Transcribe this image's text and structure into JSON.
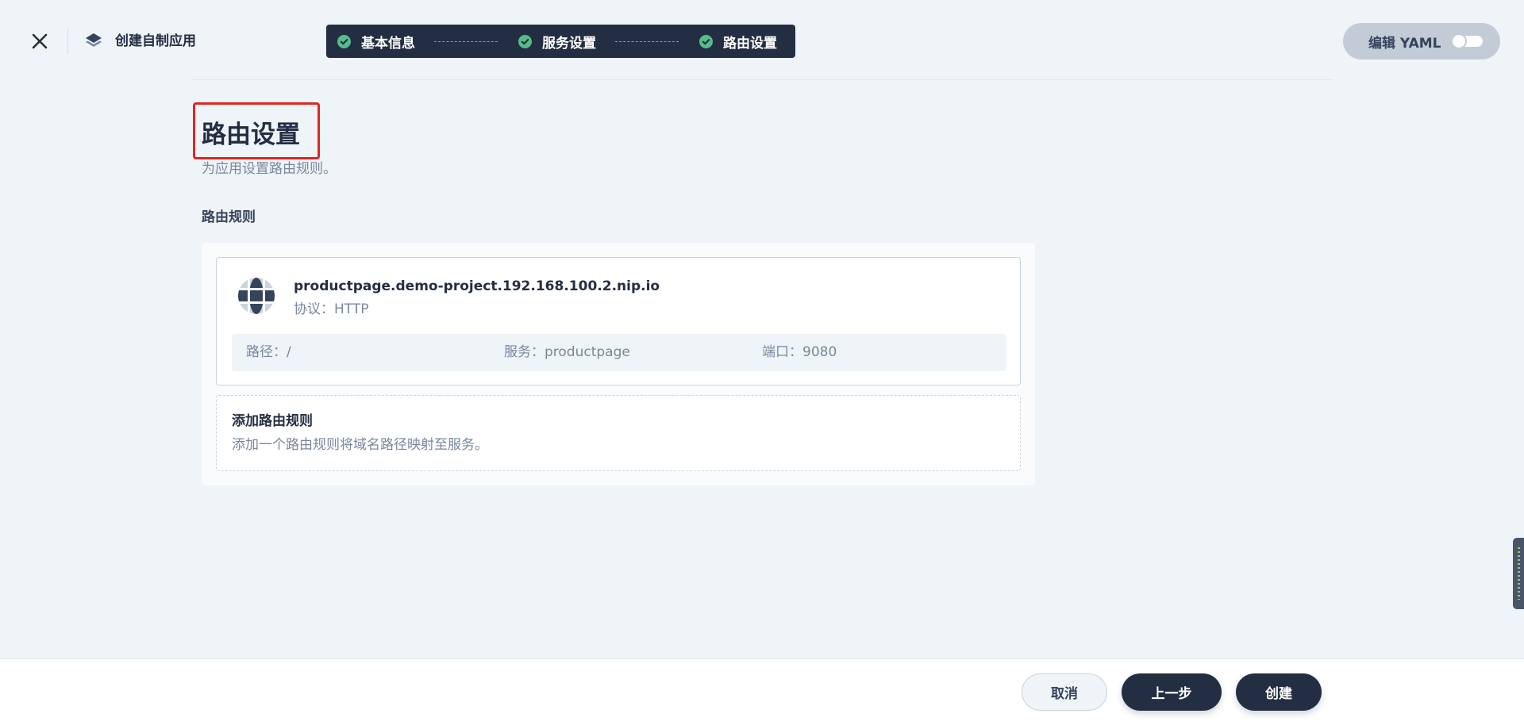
{
  "header": {
    "app_title": "创建自制应用",
    "steps": [
      {
        "label": "基本信息",
        "status": "done"
      },
      {
        "label": "服务设置",
        "status": "done"
      },
      {
        "label": "路由设置",
        "status": "done"
      }
    ],
    "yaml_toggle": {
      "label": "编辑 YAML",
      "enabled": false
    }
  },
  "main": {
    "title": "路由设置",
    "description": "为应用设置路由规则。",
    "section_label": "路由规则",
    "rules": [
      {
        "host": "productpage.demo-project.192.168.100.2.nip.io",
        "protocol": "协议：HTTP",
        "path": "路径：/",
        "service": "服务：productpage",
        "port": "端口：9080"
      }
    ],
    "add_rule": {
      "title": "添加路由规则",
      "description": "添加一个路由规则将域名路径映射至服务。"
    }
  },
  "footer": {
    "cancel_label": "取消",
    "prev_label": "上一步",
    "create_label": "创建"
  },
  "colors": {
    "background": "#eff4f9",
    "primary_dark": "#242e42",
    "success_check": "#55bc8a",
    "highlight": "#e52420"
  }
}
